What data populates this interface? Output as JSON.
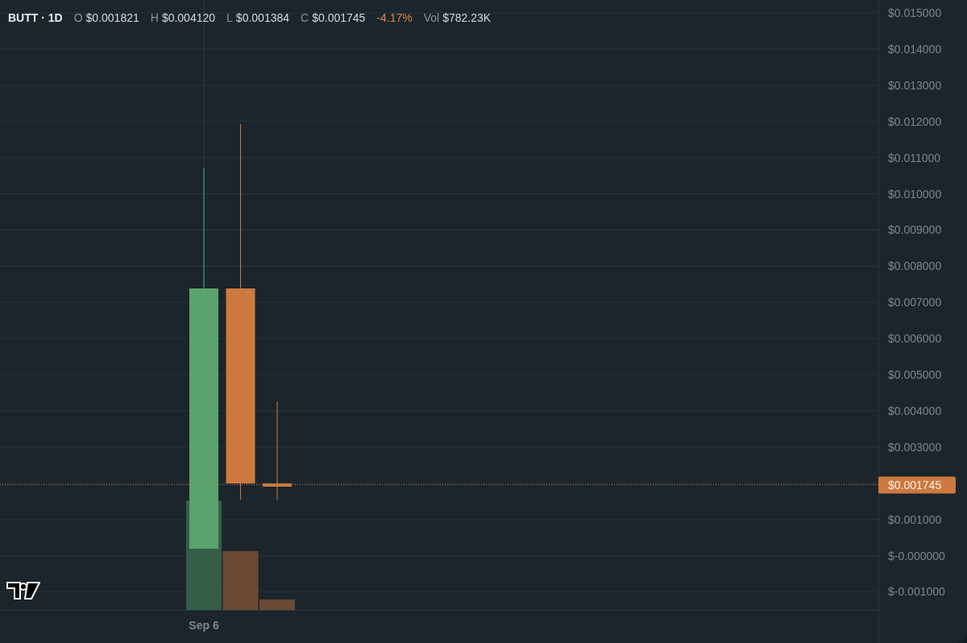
{
  "legend": {
    "symbol": "BUTT · 1D",
    "fields": [
      {
        "key": "O",
        "value": "$0.001821"
      },
      {
        "key": "H",
        "value": "$0.004120"
      },
      {
        "key": "L",
        "value": "$0.001384"
      },
      {
        "key": "C",
        "value": "$0.001745"
      }
    ],
    "change": {
      "text": "-4.17%",
      "color": "#d9844a"
    },
    "volume": {
      "key": "Vol",
      "value": "$782.23K"
    }
  },
  "chart": {
    "price_axis_upper": [
      "$0.015000",
      "$0.014000",
      "$0.013000",
      "$0.012000",
      "$0.011000",
      "$0.010000",
      "$0.009000",
      "$0.008000",
      "$0.007000",
      "$0.006000",
      "$0.005000",
      "$0.004000",
      "$0.003000"
    ],
    "price_axis_lower": [
      "$0.001000",
      "$-0.000000",
      "$-0.001000"
    ],
    "time_label": "Sep 6",
    "last_price_label": "$0.001745",
    "volume_bars": [
      {
        "color": "#355e48"
      },
      {
        "color": "#6b4a35"
      },
      {
        "color": "#6b4a35"
      }
    ]
  }
}
